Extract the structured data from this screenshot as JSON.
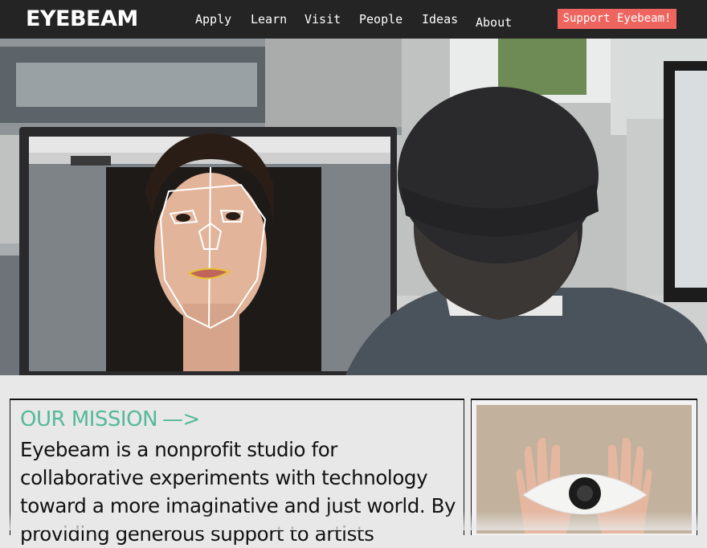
{
  "header": {
    "logo": "EYEBEAM",
    "nav": [
      {
        "label": "Apply"
      },
      {
        "label": "Learn"
      },
      {
        "label": "Visit"
      },
      {
        "label": "People"
      },
      {
        "label": "Ideas"
      },
      {
        "label": "About"
      }
    ],
    "support_label": "Support Eyebeam!"
  },
  "mission": {
    "heading": "OUR MISSION",
    "arrow": "—>",
    "text": "Eyebeam is a nonprofit studio for collaborative experiments with technology toward a more imaginative and just world. By providing generous support to artists"
  },
  "colors": {
    "accent": "#55b99a",
    "support_bg": "#ee655f",
    "header_bg": "#242424"
  }
}
